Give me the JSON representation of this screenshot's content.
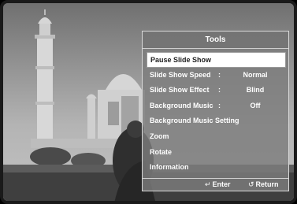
{
  "tools": {
    "title": "Tools",
    "items": [
      {
        "label": "Pause Slide Show",
        "separator": "",
        "value": ""
      },
      {
        "label": "Slide Show Speed",
        "separator": ":",
        "value": "Normal"
      },
      {
        "label": "Slide Show Effect",
        "separator": ":",
        "value": "Blind"
      },
      {
        "label": "Background Music",
        "separator": ":",
        "value": "Off"
      },
      {
        "label": "Background Music Setting",
        "separator": "",
        "value": ""
      },
      {
        "label": "Zoom",
        "separator": "",
        "value": ""
      },
      {
        "label": "Rotate",
        "separator": "",
        "value": ""
      },
      {
        "label": "Information",
        "separator": "",
        "value": ""
      }
    ],
    "selected_index": 0,
    "footer": {
      "enter_icon": "enter-icon",
      "enter_label": "Enter",
      "return_icon": "return-icon",
      "return_label": "Return"
    }
  },
  "colors": {
    "panel_bg": "#7d7d7d",
    "selected_bg": "#ffffff",
    "text": "#ffffff",
    "selected_text": "#222222"
  }
}
